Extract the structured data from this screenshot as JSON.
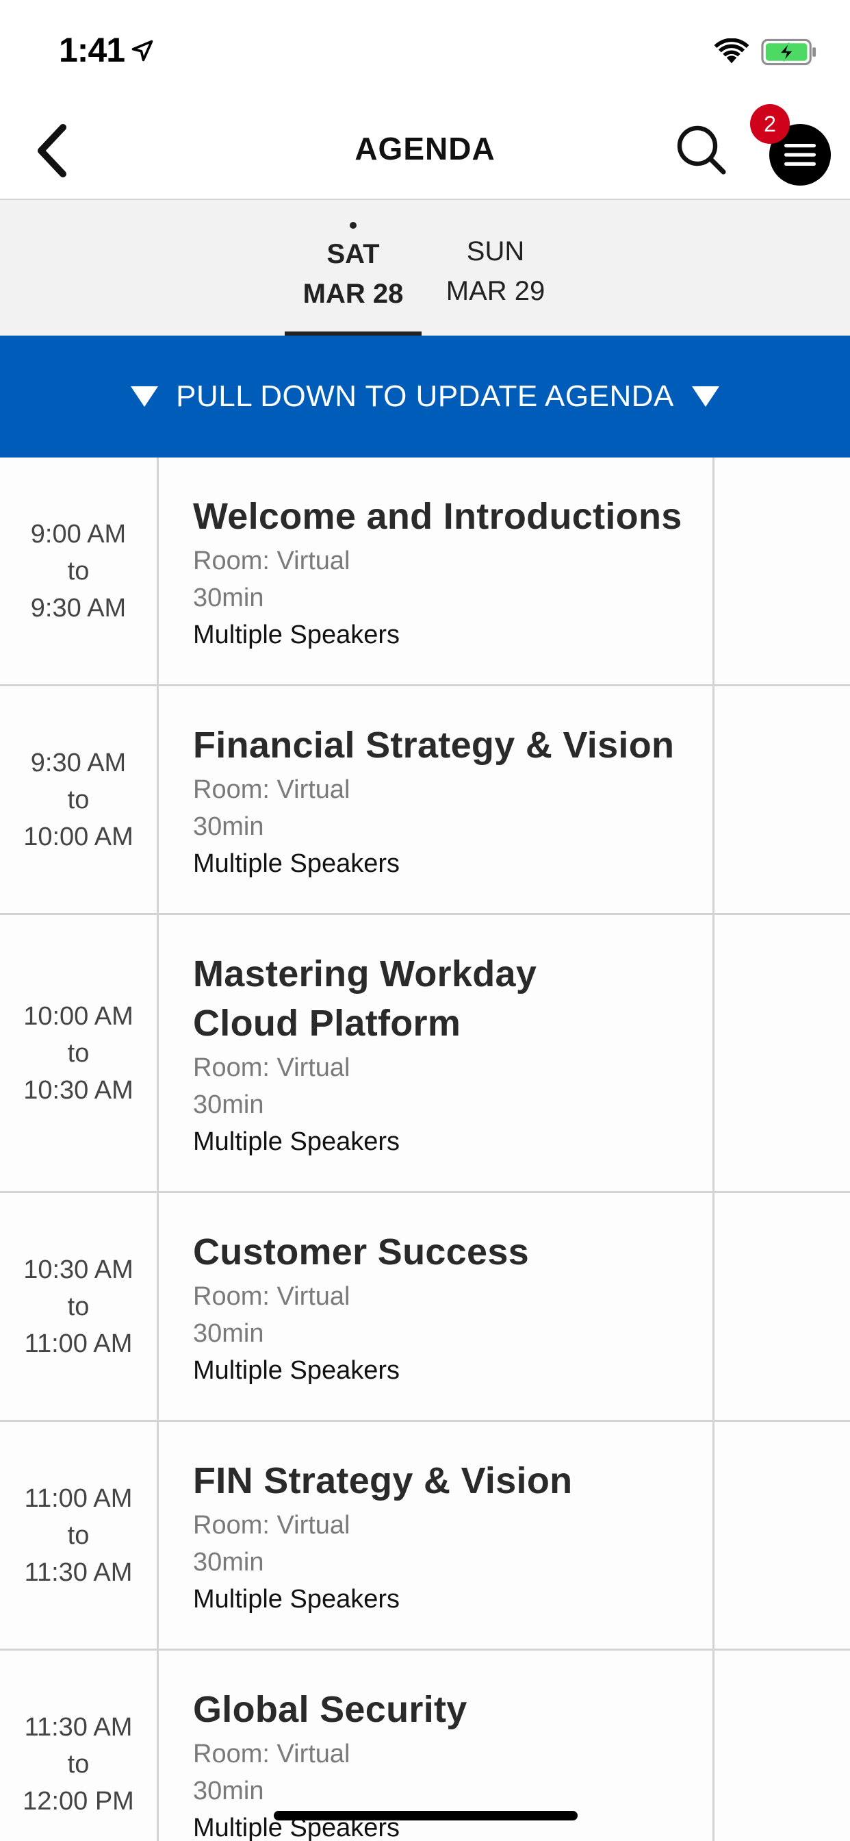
{
  "status_bar": {
    "time": "1:41"
  },
  "nav": {
    "title": "AGENDA",
    "badge_count": "2"
  },
  "date_tabs": [
    {
      "day": "SAT",
      "date": "MAR 28",
      "selected": true
    },
    {
      "day": "SUN",
      "date": "MAR 29",
      "selected": false
    }
  ],
  "banner": {
    "text": "PULL DOWN TO UPDATE AGENDA"
  },
  "sessions": [
    {
      "start": "9:00 AM",
      "to": "to",
      "end": "9:30 AM",
      "title": "Welcome and Introductions",
      "room": "Room: Virtual",
      "duration": "30min",
      "speakers": "Multiple Speakers"
    },
    {
      "start": "9:30 AM",
      "to": "to",
      "end": "10:00 AM",
      "title": "Financial Strategy & Vision",
      "room": "Room: Virtual",
      "duration": "30min",
      "speakers": "Multiple Speakers"
    },
    {
      "start": "10:00 AM",
      "to": "to",
      "end": "10:30 AM",
      "title": "Mastering Workday Cloud Platform",
      "room": "Room: Virtual",
      "duration": "30min",
      "speakers": "Multiple Speakers"
    },
    {
      "start": "10:30 AM",
      "to": "to",
      "end": "11:00 AM",
      "title": "Customer Success",
      "room": "Room: Virtual",
      "duration": "30min",
      "speakers": "Multiple Speakers"
    },
    {
      "start": "11:00 AM",
      "to": "to",
      "end": "11:30 AM",
      "title": "FIN Strategy & Vision",
      "room": "Room: Virtual",
      "duration": "30min",
      "speakers": "Multiple Speakers"
    },
    {
      "start": "11:30 AM",
      "to": "to",
      "end": "12:00 PM",
      "title": "Global Security",
      "room": "Room: Virtual",
      "duration": "30min",
      "speakers": "Multiple Speakers"
    }
  ],
  "colors": {
    "banner": "#005cb9",
    "badge": "#d0021b",
    "battery": "#4cd964"
  },
  "icons": [
    "location-arrow-icon",
    "wifi-icon",
    "battery-charging-icon",
    "back-chevron-icon",
    "search-icon",
    "hamburger-menu-icon",
    "down-triangle-icon"
  ]
}
